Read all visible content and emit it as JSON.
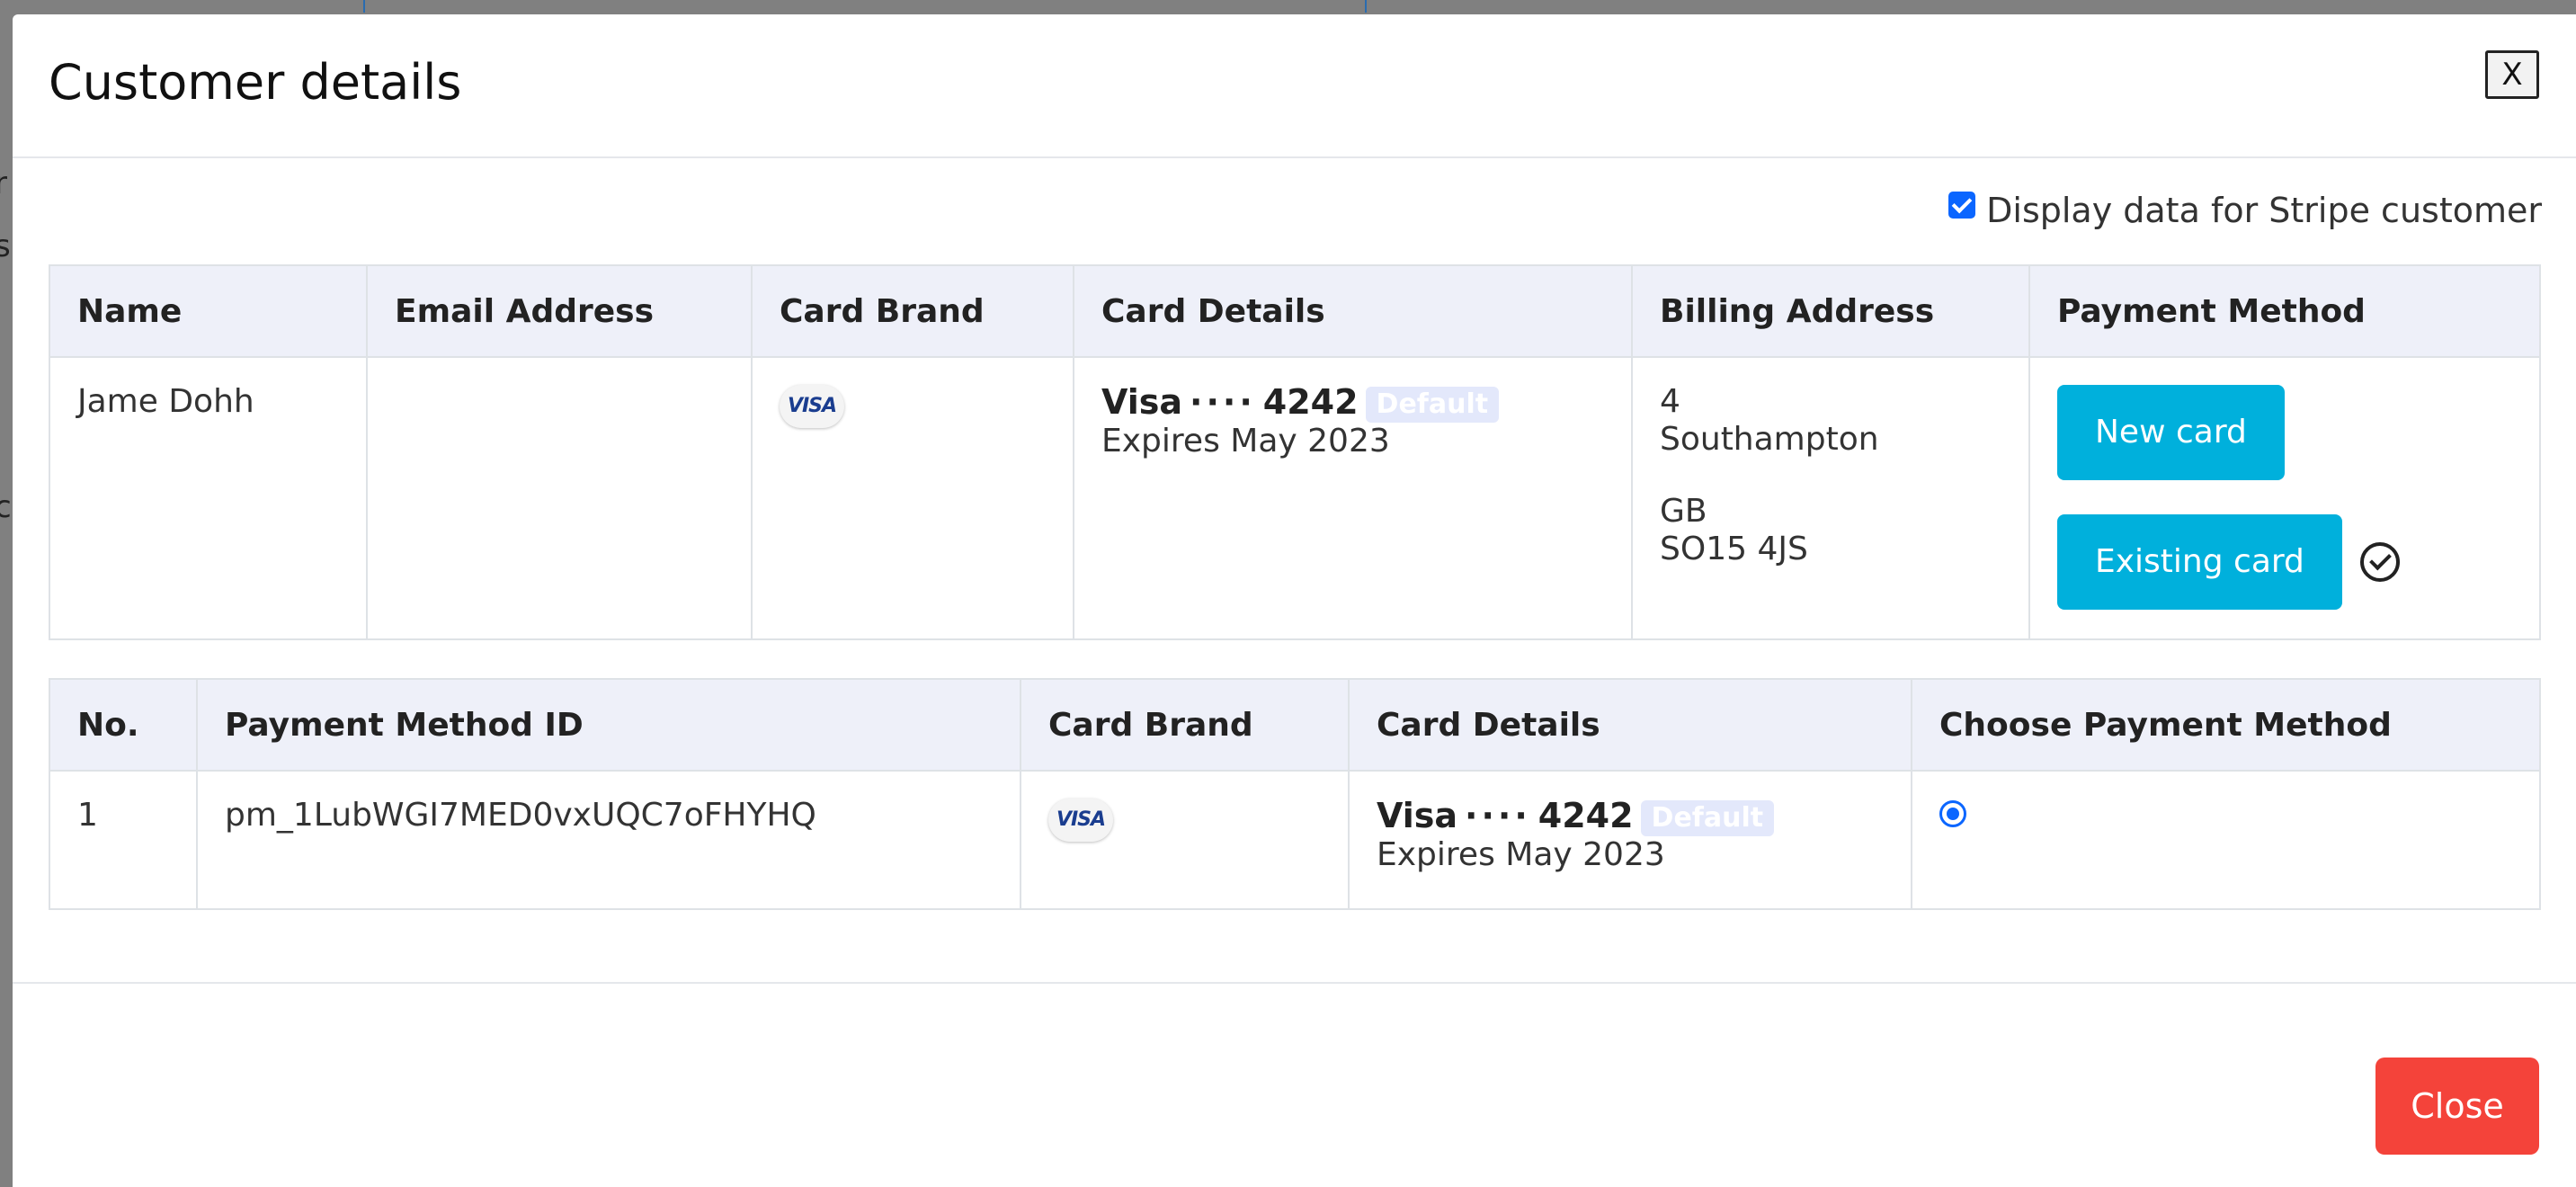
{
  "backdrop": {
    "fragments": [
      "r",
      "s",
      "c"
    ]
  },
  "modal": {
    "title": "Customer details",
    "close_x_label": "X",
    "stripe_toggle_label": "Display data for Stripe customer",
    "stripe_toggle_checked": true,
    "footer_close_label": "Close"
  },
  "customer_table": {
    "headers": [
      "Name",
      "Email Address",
      "Card Brand",
      "Card Details",
      "Billing Address",
      "Payment Method"
    ],
    "row": {
      "name": "Jame Dohh",
      "email": "",
      "card_brand_icon": "visa-icon",
      "card_brand_text": "VISA",
      "card_brand": "Visa",
      "card_dots": "····",
      "card_last4": "4242",
      "default_badge": "Default",
      "expires": "Expires May 2023",
      "billing_address": {
        "line1": "4",
        "city": "Southampton",
        "country": "GB",
        "postcode": "SO15 4JS"
      },
      "new_card_label": "New card",
      "existing_card_label": "Existing card"
    }
  },
  "methods_table": {
    "headers": [
      "No.",
      "Payment Method ID",
      "Card Brand",
      "Card Details",
      "Choose Payment Method"
    ],
    "rows": [
      {
        "no": "1",
        "pm_id": "pm_1LubWGI7MED0vxUQC7oFHYHQ",
        "card_brand_text": "VISA",
        "card_brand": "Visa",
        "card_dots": "····",
        "card_last4": "4242",
        "default_badge": "Default",
        "expires": "Expires May 2023",
        "selected": true
      }
    ]
  },
  "colors": {
    "primary_button": "#00b0dc",
    "close_button": "#f4433a",
    "header_bg": "#eef0f9",
    "accent_blue": "#0b66ff"
  }
}
